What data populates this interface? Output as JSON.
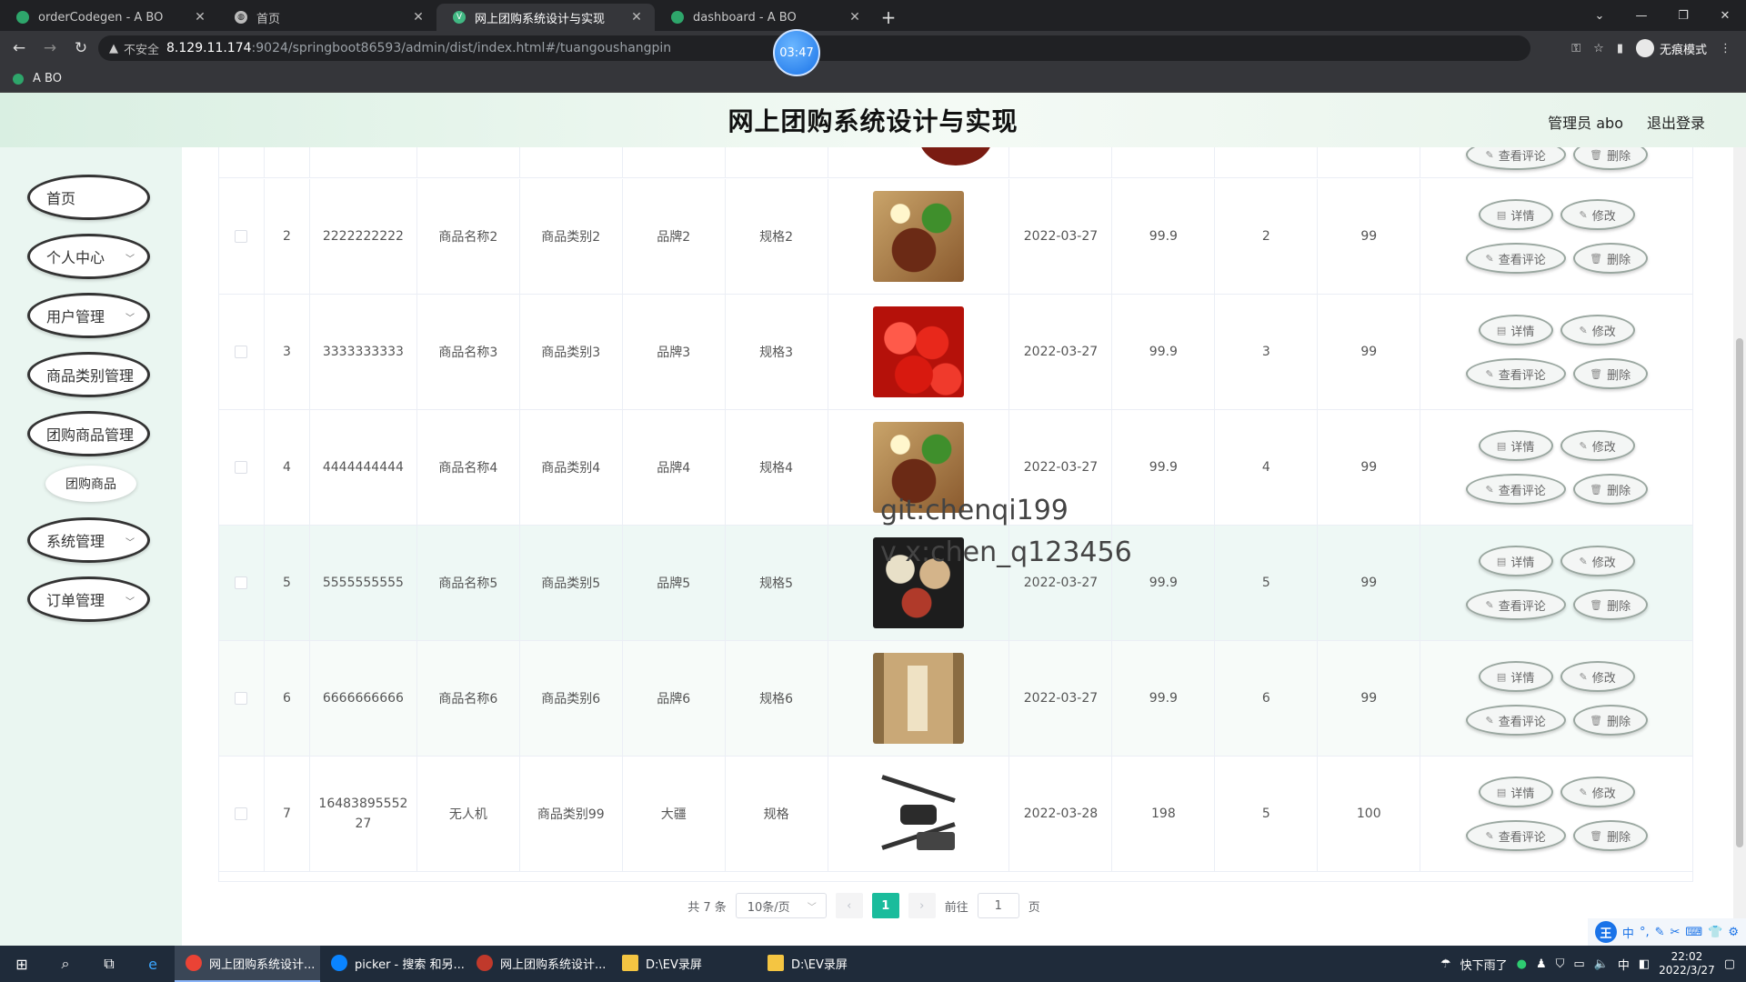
{
  "browser": {
    "tabs": [
      {
        "title": "orderCodegen - A BO",
        "active": false
      },
      {
        "title": "首页",
        "active": false
      },
      {
        "title": "网上团购系统设计与实现",
        "active": true
      },
      {
        "title": "dashboard - A BO",
        "active": false
      }
    ],
    "security_label": "不安全",
    "url_host": "8.129.11.174",
    "url_path": ":9024/springboot86593/admin/dist/index.html#/tuangoushangpin",
    "profile_label": "无痕模式",
    "bookmark": "A BO",
    "timer": "03:47"
  },
  "header": {
    "title": "网上团购系统设计与实现",
    "user": "管理员 abo",
    "logout": "退出登录"
  },
  "sidebar": {
    "items": [
      {
        "label": "首页"
      },
      {
        "label": "个人中心"
      },
      {
        "label": "用户管理"
      },
      {
        "label": "商品类别管理"
      },
      {
        "label": "团购商品管理"
      },
      {
        "label": "系统管理"
      },
      {
        "label": "订单管理"
      }
    ],
    "submenu": "团购商品"
  },
  "table": {
    "actions": {
      "detail": "详情",
      "edit": "修改",
      "reviews": "查看评论",
      "delete": "删除"
    },
    "rows": [
      {
        "idx": "2",
        "no": "2222222222",
        "name": "商品名称2",
        "category": "商品类别2",
        "brand": "品牌2",
        "spec": "规格2",
        "image": "food",
        "date": "2022-03-27",
        "price": "99.9",
        "stock": "2",
        "limit": "99"
      },
      {
        "idx": "3",
        "no": "3333333333",
        "name": "商品名称3",
        "category": "商品类别3",
        "brand": "品牌3",
        "spec": "规格3",
        "image": "cherry",
        "date": "2022-03-27",
        "price": "99.9",
        "stock": "3",
        "limit": "99"
      },
      {
        "idx": "4",
        "no": "4444444444",
        "name": "商品名称4",
        "category": "商品类别4",
        "brand": "品牌4",
        "spec": "规格4",
        "image": "food",
        "date": "2022-03-27",
        "price": "99.9",
        "stock": "4",
        "limit": "99"
      },
      {
        "idx": "5",
        "no": "5555555555",
        "name": "商品名称5",
        "category": "商品类别5",
        "brand": "品牌5",
        "spec": "规格5",
        "image": "dishes",
        "date": "2022-03-27",
        "price": "99.9",
        "stock": "5",
        "limit": "99"
      },
      {
        "idx": "6",
        "no": "6666666666",
        "name": "商品名称6",
        "category": "商品类别6",
        "brand": "品牌6",
        "spec": "规格6",
        "image": "book",
        "date": "2022-03-27",
        "price": "99.9",
        "stock": "6",
        "limit": "99"
      },
      {
        "idx": "7",
        "no": "16483895552 27",
        "name": "无人机",
        "category": "商品类别99",
        "brand": "大疆",
        "spec": "规格",
        "image": "drone",
        "date": "2022-03-28",
        "price": "198",
        "stock": "5",
        "limit": "100"
      }
    ]
  },
  "watermark": {
    "line1": "git:chenqi199",
    "line2": "v x:chen_q123456"
  },
  "pagination": {
    "total": "共 7 条",
    "page_size": "10条/页",
    "current": "1",
    "goto_label": "前往",
    "goto_value": "1",
    "page_suffix": "页"
  },
  "ime": {
    "logo": "王",
    "mode": "中"
  },
  "taskbar": {
    "apps": [
      {
        "label": "网上团购系统设计...",
        "color": "#ea4335",
        "active": true
      },
      {
        "label": "picker - 搜索 和另...",
        "color": "#0a84ff",
        "active": false
      },
      {
        "label": "网上团购系统设计...",
        "color": "#c0392b",
        "active": false
      },
      {
        "label": "D:\\EV录屏",
        "color": "#f4c542",
        "active": false
      },
      {
        "label": "D:\\EV录屏",
        "color": "#f4c542",
        "active": false
      }
    ],
    "weather": "快下雨了",
    "tray_lang": "中",
    "time": "22:02",
    "date": "2022/3/27"
  }
}
